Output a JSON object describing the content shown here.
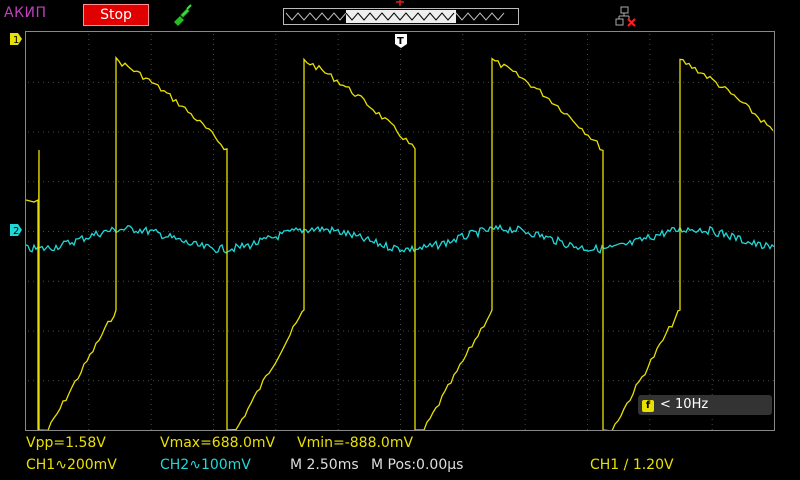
{
  "top": {
    "brand": "АКИП",
    "run_state": "Stop"
  },
  "markers": {
    "ch1": "1",
    "ch2": "2",
    "trigger": "T"
  },
  "frequency": {
    "label": "< 10Hz"
  },
  "measurements": {
    "vpp": "Vpp=1.58V",
    "vmax": "Vmax=688.0mV",
    "vmin": "Vmin=-888.0mV"
  },
  "status": {
    "ch1": "CH1∿200mV",
    "ch2": "CH2∿100mV",
    "timebase": "M 2.50ms",
    "mpos": "M Pos:0.00µs",
    "trigger": "CH1 ∕ 1.20V"
  },
  "colors": {
    "ch1": "#e8e000",
    "ch2": "#20d8d8",
    "grid": "#4a4a4a",
    "stop": "#e00000"
  }
}
